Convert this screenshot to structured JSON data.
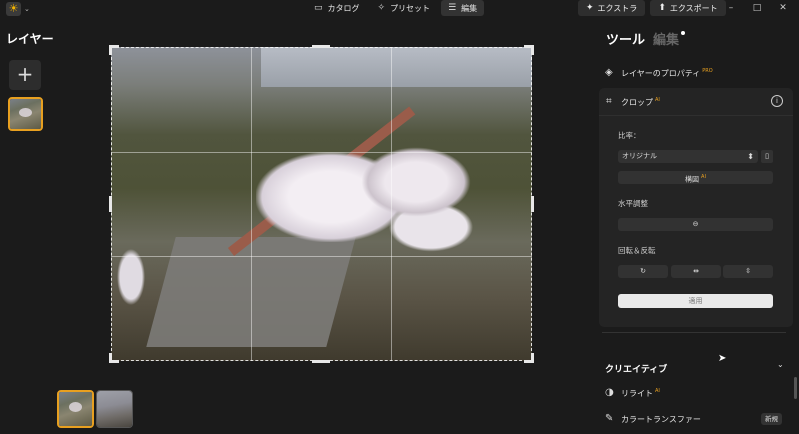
{
  "titlebar": {
    "app_logo_icon": "sun-icon",
    "tabs": [
      {
        "label": "カタログ",
        "icon": "folder-icon"
      },
      {
        "label": "プリセット",
        "icon": "sparkle-wand-icon"
      },
      {
        "label": "編集",
        "icon": "sliders-icon",
        "active": true
      }
    ],
    "export_actions": [
      {
        "label": "エクストラ",
        "icon": "sparkle-icon"
      },
      {
        "label": "エクスポート",
        "icon": "upload-icon"
      }
    ],
    "window_controls": {
      "minimize": "–",
      "maximize": "□",
      "close": "✕"
    }
  },
  "layers": {
    "title": "レイヤー",
    "add_label": "+"
  },
  "filmstrip": {
    "count": 2,
    "selected_index": 0
  },
  "tools_panel": {
    "tab_tools": "ツール",
    "tab_edit": "編集",
    "layer_properties": {
      "label": "レイヤーのプロパティ",
      "badge": "PRO"
    },
    "crop": {
      "label": "クロップ",
      "badge": "AI",
      "info_icon_text": "i",
      "ratio_label": "比率：",
      "ratio_value": "オリジナル",
      "composition_label": "構図",
      "composition_badge": "AI",
      "straighten_label": "水平調整",
      "rotate_flip_label": "回転＆反転",
      "apply_label": "適用"
    },
    "creative": {
      "title": "クリエイティブ",
      "items": [
        {
          "label": "リライト",
          "badge": "AI",
          "icon": "relight-icon"
        },
        {
          "label": "カラートランスファー",
          "badge": "新規",
          "icon": "palette-transfer-icon"
        }
      ]
    }
  }
}
